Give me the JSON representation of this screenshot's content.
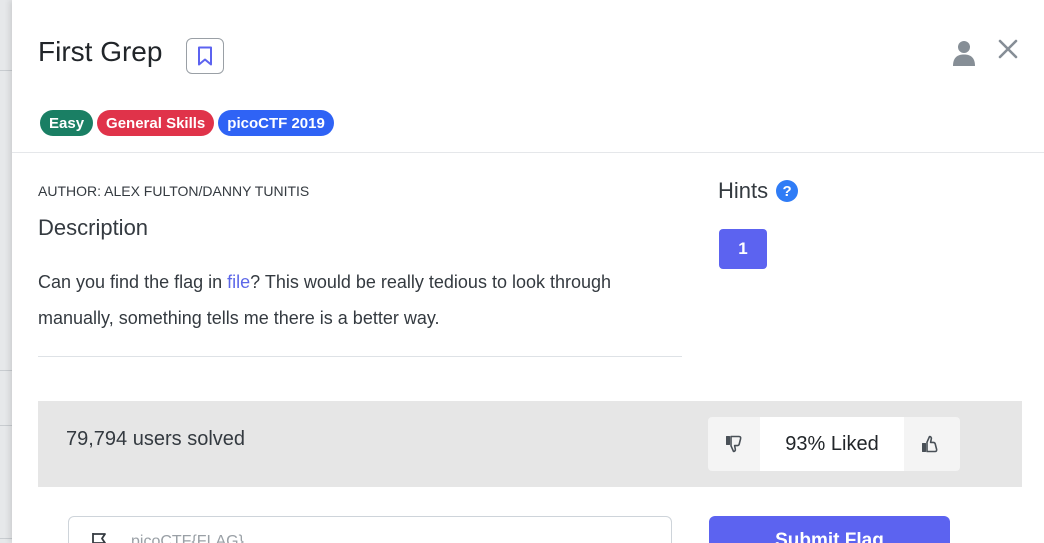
{
  "challenge": {
    "title": "First Grep",
    "tags": [
      {
        "label": "Easy",
        "color": "#1a7f64"
      },
      {
        "label": "General Skills",
        "color": "#e0334a"
      },
      {
        "label": "picoCTF 2019",
        "color": "#2f63f5"
      }
    ],
    "author": "AUTHOR: ALEX FULTON/DANNY TUNITIS",
    "description_heading": "Description",
    "description_before": "Can you find the flag in ",
    "description_link": "file",
    "description_after": "? This would be really tedious to look through manually, something tells me there is a better way."
  },
  "hints": {
    "title": "Hints",
    "help_icon": "?",
    "items": [
      "1"
    ]
  },
  "stats": {
    "solved": "79,794 users solved",
    "liked": "93% Liked"
  },
  "flag_form": {
    "placeholder": "picoCTF{FLAG}",
    "submit_label": "Submit Flag"
  },
  "colors": {
    "accent": "#5c63f0",
    "link": "#5c67e8",
    "help": "#2f7cf6"
  }
}
